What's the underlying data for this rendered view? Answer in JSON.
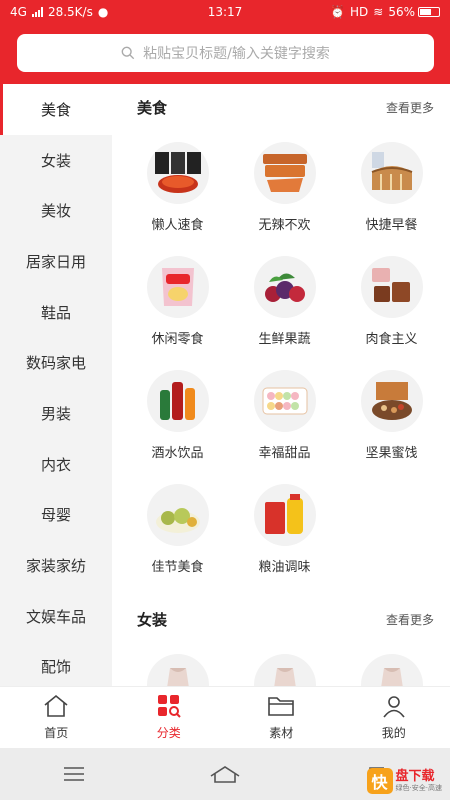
{
  "status_bar": {
    "network": "4G",
    "speed": "28.5K/s",
    "time": "13:17",
    "battery": "56%",
    "extra": "HD"
  },
  "search": {
    "placeholder": "粘贴宝贝标题/输入关键字搜索"
  },
  "colors": {
    "brand": "#e8262c",
    "sidebar_bg": "#f3f3f3"
  },
  "sidebar": {
    "items": [
      {
        "label": "美食",
        "active": true
      },
      {
        "label": "女装"
      },
      {
        "label": "美妆"
      },
      {
        "label": "居家日用"
      },
      {
        "label": "鞋品"
      },
      {
        "label": "数码家电"
      },
      {
        "label": "男装"
      },
      {
        "label": "内衣"
      },
      {
        "label": "母婴"
      },
      {
        "label": "家装家纺"
      },
      {
        "label": "文娱车品"
      },
      {
        "label": "配饰"
      }
    ]
  },
  "sections": [
    {
      "title": "美食",
      "more": "查看更多",
      "items": [
        {
          "label": "懒人速食",
          "icon": "instant-food-icon"
        },
        {
          "label": "无辣不欢",
          "icon": "spicy-snack-icon"
        },
        {
          "label": "快捷早餐",
          "icon": "bread-icon"
        },
        {
          "label": "休闲零食",
          "icon": "chips-bag-icon"
        },
        {
          "label": "生鲜果蔬",
          "icon": "fruit-icon"
        },
        {
          "label": "肉食主义",
          "icon": "meat-icon"
        },
        {
          "label": "酒水饮品",
          "icon": "drinks-icon"
        },
        {
          "label": "幸福甜品",
          "icon": "macaron-icon"
        },
        {
          "label": "坚果蜜饯",
          "icon": "nuts-icon"
        },
        {
          "label": "佳节美食",
          "icon": "dumpling-icon"
        },
        {
          "label": "粮油调味",
          "icon": "oil-rice-icon"
        }
      ]
    },
    {
      "title": "女装",
      "more": "查看更多",
      "items": [
        {
          "label": "",
          "icon": "dress-icon"
        },
        {
          "label": "",
          "icon": "dress-icon"
        },
        {
          "label": "",
          "icon": "dress-icon"
        }
      ]
    }
  ],
  "tabbar": {
    "items": [
      {
        "label": "首页",
        "icon": "home-icon"
      },
      {
        "label": "分类",
        "icon": "category-icon",
        "active": true
      },
      {
        "label": "素材",
        "icon": "folder-icon"
      },
      {
        "label": "我的",
        "icon": "user-icon"
      }
    ]
  },
  "watermark": {
    "badge": "快",
    "title": "盘下载",
    "subtitle": "绿色·安全·高速"
  }
}
